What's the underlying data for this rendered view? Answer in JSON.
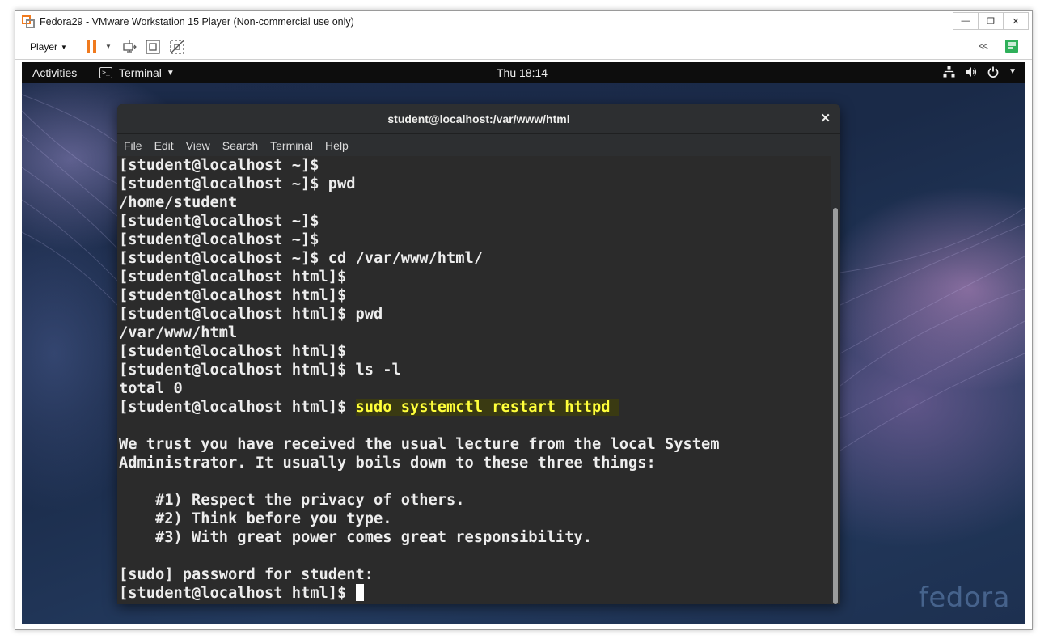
{
  "vm": {
    "title": "Fedora29 - VMware Workstation 15 Player (Non-commercial use only)",
    "player_label": "Player",
    "accent": "#f07a1e"
  },
  "gnome": {
    "activities": "Activities",
    "app_menu": "Terminal",
    "clock": "Thu 18:14",
    "watermark": "fedora"
  },
  "terminal": {
    "title": "student@localhost:/var/www/html",
    "menu": [
      "File",
      "Edit",
      "View",
      "Search",
      "Terminal",
      "Help"
    ],
    "lines": [
      "[student@localhost ~]$",
      "[student@localhost ~]$ pwd",
      "/home/student",
      "[student@localhost ~]$",
      "[student@localhost ~]$",
      "[student@localhost ~]$ cd /var/www/html/",
      "[student@localhost html]$",
      "[student@localhost html]$",
      "[student@localhost html]$ pwd",
      "/var/www/html",
      "[student@localhost html]$",
      "[student@localhost html]$ ls -l",
      "total 0"
    ],
    "highlight_prompt": "[student@localhost html]$ ",
    "highlight_command": "sudo systemctl restart httpd ",
    "lines_after": [
      "",
      "We trust you have received the usual lecture from the local System",
      "Administrator. It usually boils down to these three things:",
      "",
      "    #1) Respect the privacy of others.",
      "    #2) Think before you type.",
      "    #3) With great power comes great responsibility.",
      "",
      "[sudo] password for student:"
    ],
    "final_prompt": "[student@localhost html]$ "
  }
}
